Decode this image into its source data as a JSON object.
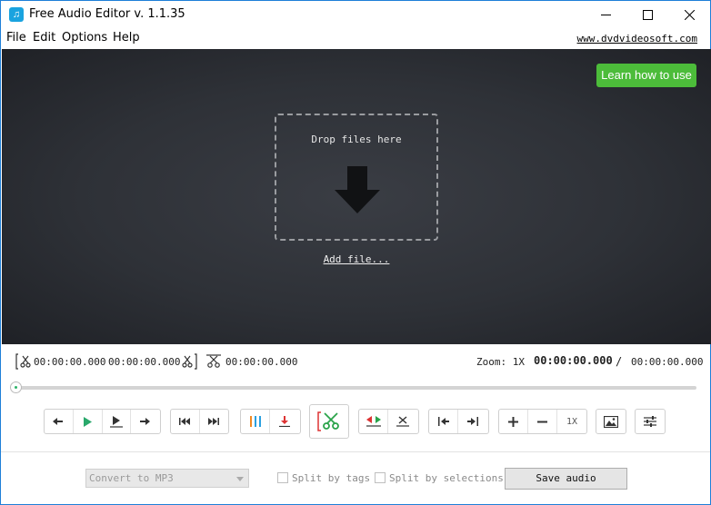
{
  "window": {
    "title": "Free Audio Editor v. 1.1.35",
    "icon": "music-note-icon"
  },
  "menu": {
    "items": [
      "File",
      "Edit",
      "Options",
      "Help"
    ],
    "site_link": "www.dvdvideosoft.com"
  },
  "stage": {
    "learn_button": "Learn how to use",
    "drop_text": "Drop files here",
    "add_file": "Add file...",
    "colors": {
      "learn": "#4cbc3a",
      "background": "#2e3137"
    }
  },
  "timing": {
    "selection_start": "00:00:00.000",
    "selection_end": "00:00:00.000",
    "selection_length": "00:00:00.000",
    "zoom_label": "Zoom: 1X",
    "current_time": "00:00:00.000",
    "separator": "/",
    "total_time": "00:00:00.000",
    "position_fraction": 0
  },
  "toolbar": {
    "zoom_level": "1X"
  },
  "bottom": {
    "format_value": "Convert to MP3",
    "split_by_tags": "Split by tags",
    "split_by_selections": "Split by selections",
    "save_button": "Save audio"
  }
}
